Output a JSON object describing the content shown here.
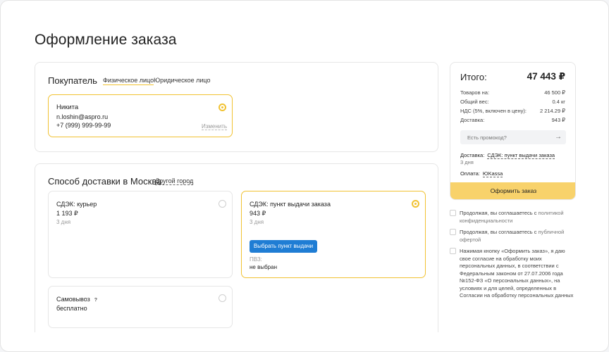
{
  "page_title": "Оформление заказа",
  "buyer": {
    "section_title": "Покупатель",
    "tabs": [
      "Физическое лицо",
      "Юридическое лицо"
    ],
    "name": "Никита",
    "email": "n.loshin@aspro.ru",
    "phone": "+7 (999) 999-99-99",
    "change_link": "Изменить"
  },
  "delivery": {
    "section_title": "Способ доставки в Москва",
    "other_city_link": "Другой город",
    "options": [
      {
        "title": "СДЭК: курьер",
        "price": "1 193 ₽",
        "days": "3 дня"
      },
      {
        "title": "СДЭК: пункт выдачи заказа",
        "price": "943 ₽",
        "days": "3 дня",
        "button": "Выбрать пункт выдачи",
        "pvz_label": "ПВЗ:",
        "pvz_value": "не выбран"
      },
      {
        "title": "Самовывоз",
        "price": "бесплатно",
        "help": "?"
      }
    ]
  },
  "summary": {
    "title": "Итого:",
    "total": "47 443 ₽",
    "rows": [
      {
        "label": "Товаров на:",
        "value": "46 500 ₽"
      },
      {
        "label": "Общий вес:",
        "value": "0.4 кг"
      },
      {
        "label": "НДС (5%, включен в цену):",
        "value": "2 214.29 ₽"
      },
      {
        "label": "Доставка:",
        "value": "943 ₽"
      }
    ],
    "promo_placeholder": "Есть промокод?",
    "delivery_label": "Доставка:",
    "delivery_value": "СДЭК: пункт выдачи заказа",
    "delivery_days": "3 дня",
    "payment_label": "Оплата:",
    "payment_value": "ЮKassa",
    "order_button": "Оформить заказ"
  },
  "agreements": [
    {
      "text": "Продолжая, вы соглашаетесь с ",
      "link": "политикой конфиденциальности"
    },
    {
      "text": "Продолжая, вы соглашаетесь с ",
      "link": "публичной офертой"
    },
    {
      "text": "Нажимая кнопку «Оформить заказ», я даю свое согласие на обработку моих персональных данных, в соответствии с Федеральным законом от 27.07.2006 года №152-ФЗ «О персональных данных», на условиях и для целей, определенных в Согласии на обработку персональных данных",
      "link": ""
    }
  ],
  "colors": {
    "accent": "#f1c232",
    "order_button": "#f8d26b",
    "select_button": "#1f7dd4"
  }
}
